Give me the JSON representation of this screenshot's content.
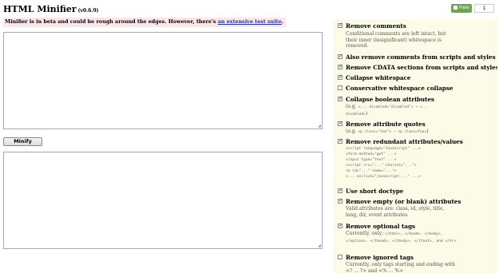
{
  "app": {
    "title": "HTML Minifier",
    "version": "(v0.6.9)"
  },
  "flattr": {
    "label": "Flattr",
    "count": "1"
  },
  "notice": {
    "text": "Minifier is in beta and could be rough around the edges. However, there's ",
    "link": "an extensive test suite",
    "suffix": "."
  },
  "minify_label": "Minify",
  "options": [
    {
      "label": "Remove comments",
      "checked": true,
      "desc": "Conditional comments are left intact, but their inner (insignificant) whitespace is removed."
    },
    {
      "label": "Also remove comments from scripts and styles",
      "checked": true
    },
    {
      "label": "Remove CDATA sections from scripts and styles",
      "checked": true
    },
    {
      "label": "Collapse whitespace",
      "checked": true
    },
    {
      "label": "Conservative whitespace collapse",
      "checked": false
    },
    {
      "label": "Collapse boolean attributes",
      "checked": true,
      "desc_prefix": "(e.g. ",
      "desc_code": "<... disabled=\"disabled\"> → <... disabled>",
      "desc_suffix": ")"
    },
    {
      "label": "Remove attribute quotes",
      "checked": true,
      "desc_prefix": "(e.g. ",
      "desc_code": "<p class=\"foo\"> → <p class=foo>",
      "desc_suffix": ")"
    },
    {
      "label": "Remove redundant attributes/values",
      "checked": true,
      "code_lines": [
        "<script language=\"Javascript\" ...>",
        "<form method=\"get\" ...>",
        "<input type=\"text\" ...>",
        "<script src=\"...\" charset=\"...\">",
        "<a id=\"...\" name=\"...\">",
        "<... onclick=\"javascript:...\" ...>"
      ]
    },
    {
      "label": "Use short doctype",
      "checked": true
    },
    {
      "label": "Remove empty (or blank) attributes",
      "checked": true,
      "desc": "Valid attributes are: class, id, style, title, lang, dir, event attributes"
    },
    {
      "label": "Remove optional tags",
      "checked": true,
      "desc_prefix": "Currently, only: ",
      "desc_code": "</html>, </head>, </body>, </option>, </thead>, </tbody>, </tfoot>, and </tr>"
    },
    {
      "label": "Remove ignored tags",
      "checked": false,
      "desc": "Currently, only tags starting and ending with <? ... ?> and <% ... %>"
    }
  ]
}
